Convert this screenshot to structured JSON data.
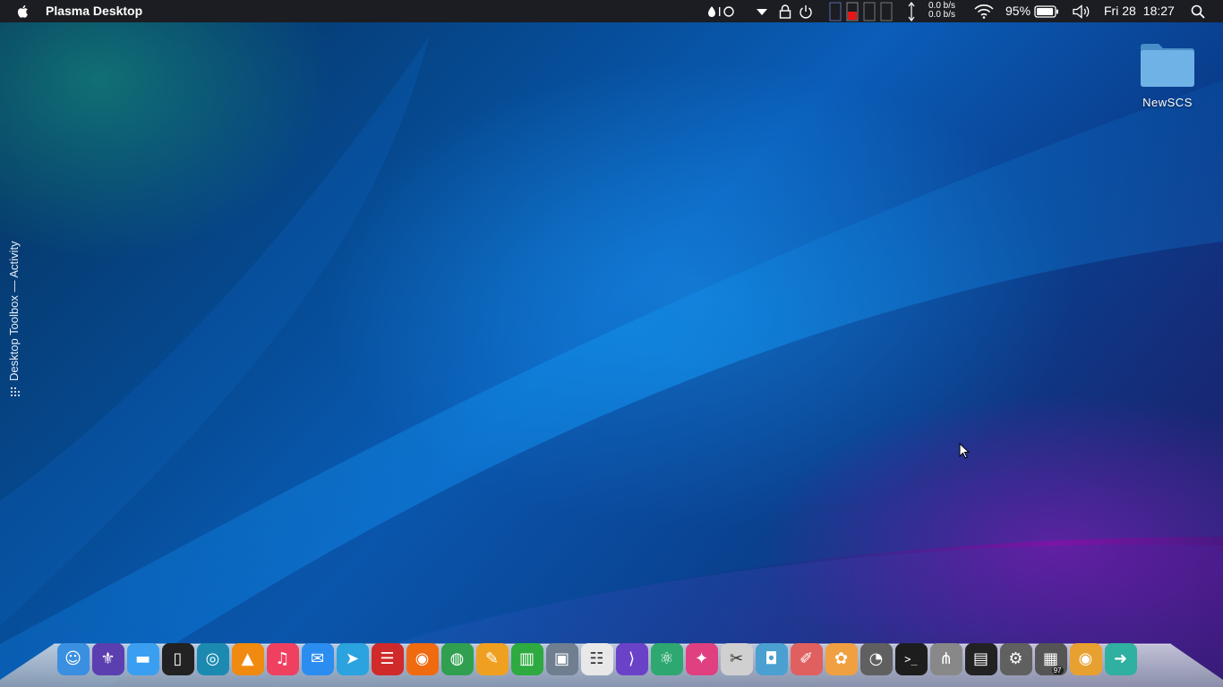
{
  "menubar": {
    "apple_icon": "apple-logo-icon",
    "app_title": "Plasma Desktop",
    "net_up": "0.0 b/s",
    "net_down": "0.0 b/s",
    "battery_percent": "95%",
    "battery_level": 0.95,
    "clock_day": "Fri 28",
    "clock_time": "18:27",
    "background": "#1b1d22"
  },
  "desktop": {
    "folder_label": "NewSCS",
    "toolbox_label": "Desktop Toolbox — Activity",
    "accent": "#0a5db8"
  },
  "dock": {
    "trash_count": "97",
    "items": [
      {
        "name": "finder",
        "icon": "finder-icon",
        "color": "#3b8fe0"
      },
      {
        "name": "krita",
        "icon": "fleur-icon",
        "color": "#5b3fb0"
      },
      {
        "name": "files",
        "icon": "folder-icon",
        "color": "#3a9ff0"
      },
      {
        "name": "kdeconnect",
        "icon": "phone-icon",
        "color": "#222"
      },
      {
        "name": "ktorrent",
        "icon": "torrent-icon",
        "color": "#1c8ab0"
      },
      {
        "name": "vlc",
        "icon": "cone-icon",
        "color": "#f08a10"
      },
      {
        "name": "music",
        "icon": "music-note-icon",
        "color": "#f04060"
      },
      {
        "name": "messenger",
        "icon": "chat-icon",
        "color": "#2c8df0"
      },
      {
        "name": "telegram",
        "icon": "paper-plane-icon",
        "color": "#2aa3df"
      },
      {
        "name": "news",
        "icon": "newspaper-icon",
        "color": "#d02a2a"
      },
      {
        "name": "firefox",
        "icon": "firefox-icon",
        "color": "#f06a10"
      },
      {
        "name": "chrome",
        "icon": "chrome-icon",
        "color": "#30a050"
      },
      {
        "name": "pages",
        "icon": "pencil-icon",
        "color": "#f0a020"
      },
      {
        "name": "numbers",
        "icon": "chart-icon",
        "color": "#2eaa40"
      },
      {
        "name": "preview",
        "icon": "photos-icon",
        "color": "#707f90"
      },
      {
        "name": "textedit",
        "icon": "document-icon",
        "color": "#e8e8e8"
      },
      {
        "name": "vscode",
        "icon": "vscode-icon",
        "color": "#6a42c8"
      },
      {
        "name": "atom",
        "icon": "atom-icon",
        "color": "#2ea870"
      },
      {
        "name": "finalcut",
        "icon": "clapper-icon",
        "color": "#e04080"
      },
      {
        "name": "screenshot",
        "icon": "scissors-icon",
        "color": "#d0d0d0"
      },
      {
        "name": "imagecapture",
        "icon": "camera-icon",
        "color": "#4aa0d0"
      },
      {
        "name": "pixelmator",
        "icon": "brush-icon",
        "color": "#e06060"
      },
      {
        "name": "photos",
        "icon": "flower-icon",
        "color": "#f0a040"
      },
      {
        "name": "diskusage",
        "icon": "gauge-icon",
        "color": "#606060"
      },
      {
        "name": "terminal",
        "icon": "terminal-icon",
        "color": "#1d1d1d"
      },
      {
        "name": "claw",
        "icon": "claw-icon",
        "color": "#888"
      },
      {
        "name": "activitymonitor",
        "icon": "monitor-icon",
        "color": "#222"
      },
      {
        "name": "systemsettings",
        "icon": "gear-icon",
        "color": "#606060"
      },
      {
        "name": "trash",
        "icon": "trash-icon",
        "color": "#555"
      },
      {
        "name": "cantata",
        "icon": "cd-icon",
        "color": "#e8a030"
      },
      {
        "name": "kdeconnect2",
        "icon": "arrow-icon",
        "color": "#2fb0a0"
      }
    ]
  }
}
